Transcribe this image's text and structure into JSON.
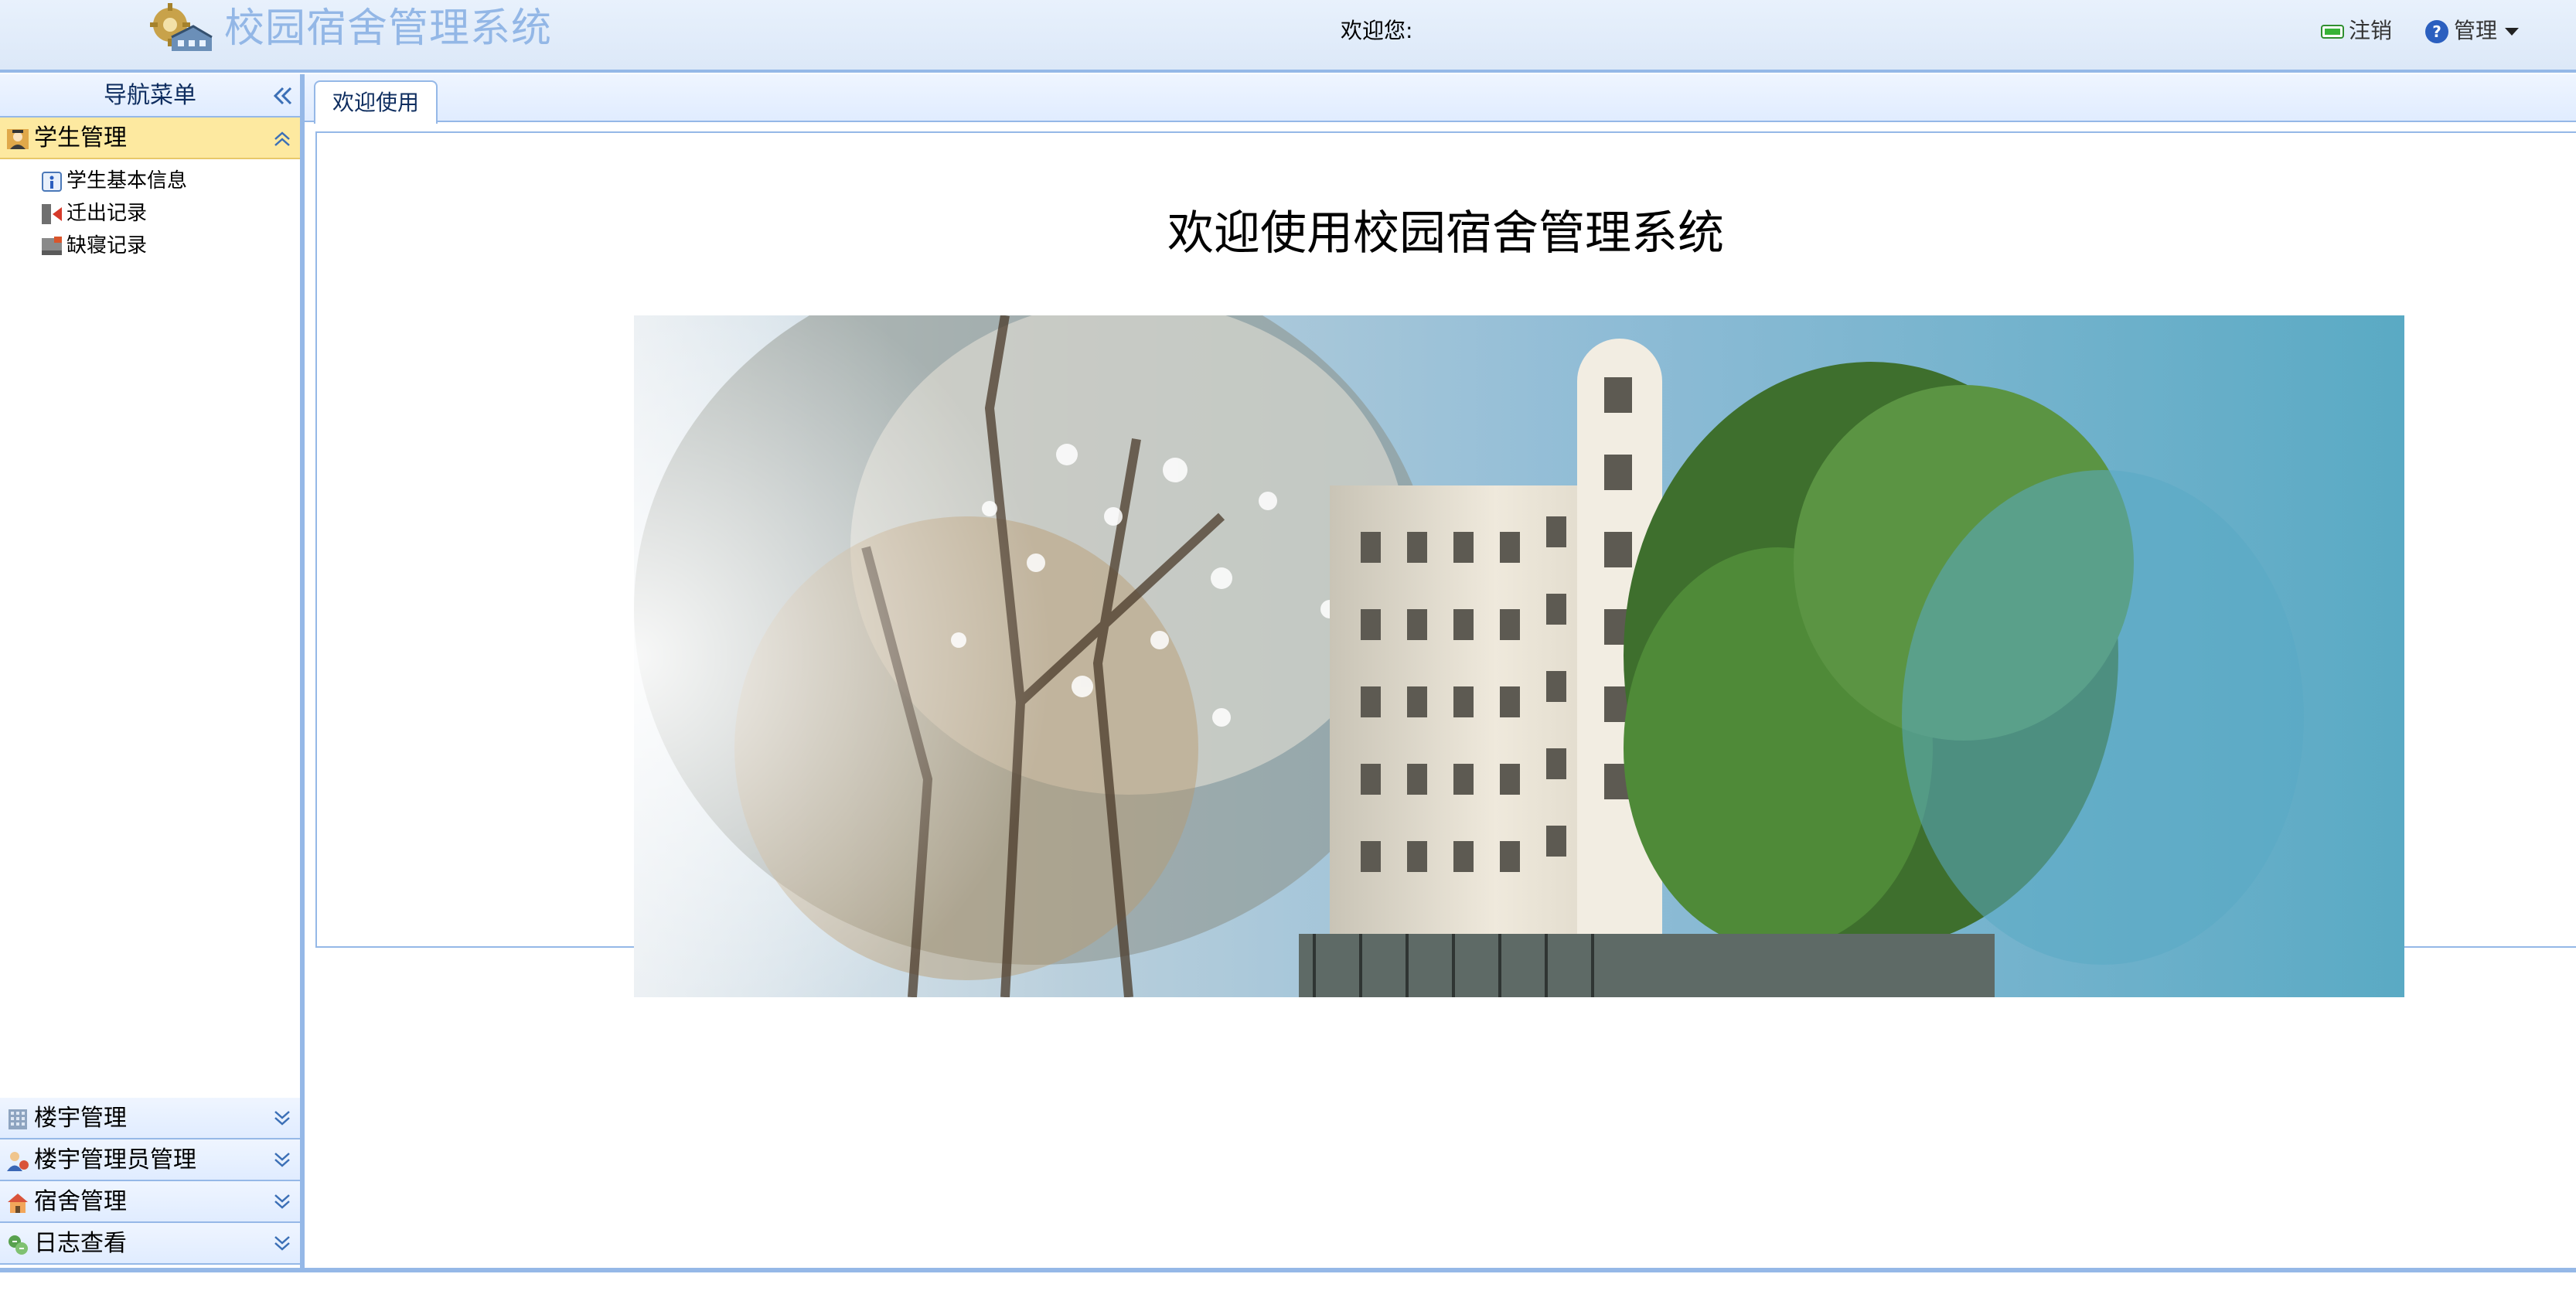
{
  "header": {
    "app_title": "校园宿舍管理系统",
    "welcome_text": "欢迎您:",
    "logout_label": "注销",
    "admin_label": "管理",
    "logo_icon": "building-with-gear-icon",
    "logout_icon": "green-bar-icon",
    "admin_icon": "help-question-icon"
  },
  "sidebar": {
    "title": "导航菜单",
    "collapse_icon": "double-chevron-left-icon",
    "sections": [
      {
        "label": "学生管理",
        "icon": "student-icon",
        "expanded": true,
        "items": [
          {
            "label": "学生基本信息",
            "icon": "info-icon"
          },
          {
            "label": "迁出记录",
            "icon": "move-out-icon"
          },
          {
            "label": "缺寝记录",
            "icon": "absence-icon"
          }
        ]
      },
      {
        "label": "楼宇管理",
        "icon": "building-grid-icon",
        "expanded": false
      },
      {
        "label": "楼宇管理员管理",
        "icon": "admin-user-icon",
        "expanded": false
      },
      {
        "label": "宿舍管理",
        "icon": "dorm-house-icon",
        "expanded": false
      },
      {
        "label": "日志查看",
        "icon": "log-icon",
        "expanded": false
      }
    ]
  },
  "main": {
    "tabs": [
      {
        "label": "欢迎使用",
        "active": true
      }
    ],
    "heading": "欢迎使用校园宿舍管理系统",
    "banner_image": "campus-dormitory-photo"
  },
  "colors": {
    "border_blue": "#95b8e7",
    "header_bg": "#dce8f8",
    "title_blue": "#93b7e6",
    "selected_yellow": "#fde9a0"
  }
}
